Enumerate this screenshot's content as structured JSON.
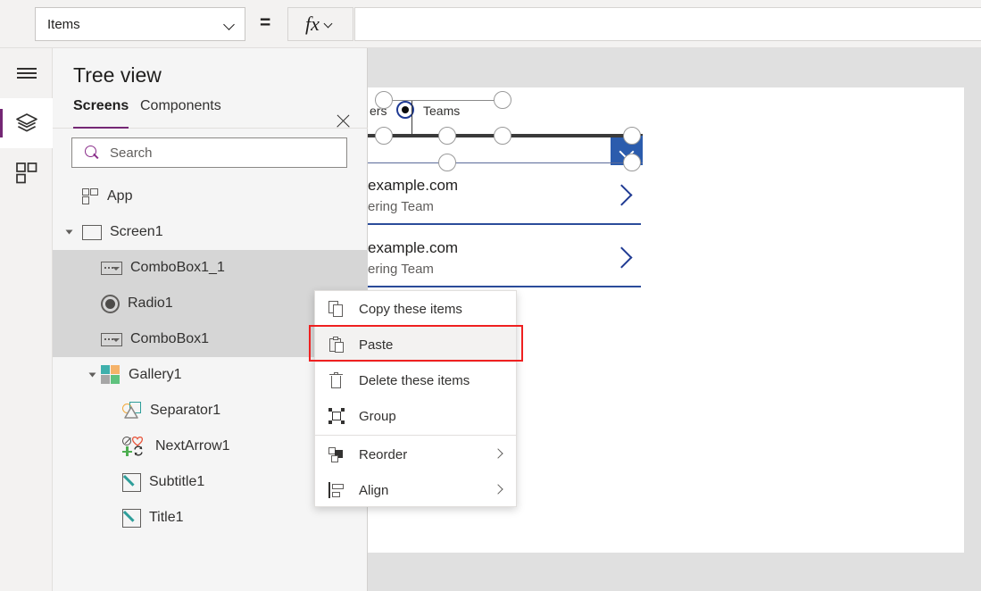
{
  "topbar": {
    "property_selector_value": "Items",
    "equals_sign": "=",
    "fx_label": "fx",
    "formula_value": ""
  },
  "rail": {
    "items": [
      {
        "icon": "hamburger-menu-icon",
        "name": "menu"
      },
      {
        "icon": "layers-icon",
        "name": "tree-view",
        "selected": true
      },
      {
        "icon": "insert-grid-icon",
        "name": "insert",
        "selected": false
      }
    ]
  },
  "panel": {
    "title": "Tree view",
    "close_icon": "close-icon",
    "tabs": [
      {
        "label": "Screens",
        "active": true
      },
      {
        "label": "Components",
        "active": false
      }
    ],
    "search": {
      "placeholder": "Search",
      "value": "",
      "icon": "search-icon"
    },
    "tree": [
      {
        "label": "App",
        "icon": "app-icon",
        "indent": 0,
        "twisty": false,
        "selected": false
      },
      {
        "label": "Screen1",
        "icon": "screen-icon",
        "indent": 0,
        "twisty": true,
        "selected": false
      },
      {
        "label": "ComboBox1_1",
        "icon": "combobox-icon",
        "indent": 1,
        "twisty": false,
        "selected": true
      },
      {
        "label": "Radio1",
        "icon": "radio-icon",
        "indent": 1,
        "twisty": false,
        "selected": true
      },
      {
        "label": "ComboBox1",
        "icon": "combobox-icon",
        "indent": 1,
        "twisty": false,
        "selected": true
      },
      {
        "label": "Gallery1",
        "icon": "gallery-icon",
        "indent": 1,
        "twisty": true,
        "selected": false
      },
      {
        "label": "Separator1",
        "icon": "shapes-icon",
        "indent": 2,
        "twisty": false,
        "selected": false
      },
      {
        "label": "NextArrow1",
        "icon": "next-arrow-icon",
        "indent": 2,
        "twisty": false,
        "selected": false
      },
      {
        "label": "Subtitle1",
        "icon": "label-edit-icon",
        "indent": 2,
        "twisty": false,
        "selected": false
      },
      {
        "label": "Title1",
        "icon": "label-edit-icon",
        "indent": 2,
        "twisty": false,
        "selected": false
      }
    ]
  },
  "canvas": {
    "radio": {
      "left_label_partial": "ers",
      "selected_option": "Teams"
    },
    "combobox": {
      "value": "",
      "dropdown_icon": "chevron-down-icon",
      "dropdown_color": "#2b5cad"
    },
    "gallery_items": [
      {
        "title": "example.com",
        "subtitle": "ering Team",
        "arrow_icon": "chevron-right-icon"
      },
      {
        "title": "example.com",
        "subtitle": "ering Team",
        "arrow_icon": "chevron-right-icon"
      }
    ]
  },
  "context_menu": {
    "items": [
      {
        "label": "Copy these items",
        "icon": "copy-icon",
        "submenu": false,
        "highlighted": false,
        "divider_after": false
      },
      {
        "label": "Paste",
        "icon": "paste-icon",
        "submenu": false,
        "highlighted": true,
        "divider_after": false
      },
      {
        "label": "Delete these items",
        "icon": "trash-icon",
        "submenu": false,
        "highlighted": false,
        "divider_after": false
      },
      {
        "label": "Group",
        "icon": "group-icon",
        "submenu": false,
        "highlighted": false,
        "divider_after": true
      },
      {
        "label": "Reorder",
        "icon": "reorder-icon",
        "submenu": true,
        "highlighted": false,
        "divider_after": false
      },
      {
        "label": "Align",
        "icon": "align-icon",
        "submenu": true,
        "highlighted": false,
        "divider_after": false
      }
    ],
    "highlight_color": "#ef2020"
  },
  "colors": {
    "accent_purple": "#742774",
    "panel_bg": "#f5f5f5",
    "selection_gray": "#d6d6d6",
    "canvas_gray": "#e0e0e0",
    "blue": "#2b5cad"
  }
}
